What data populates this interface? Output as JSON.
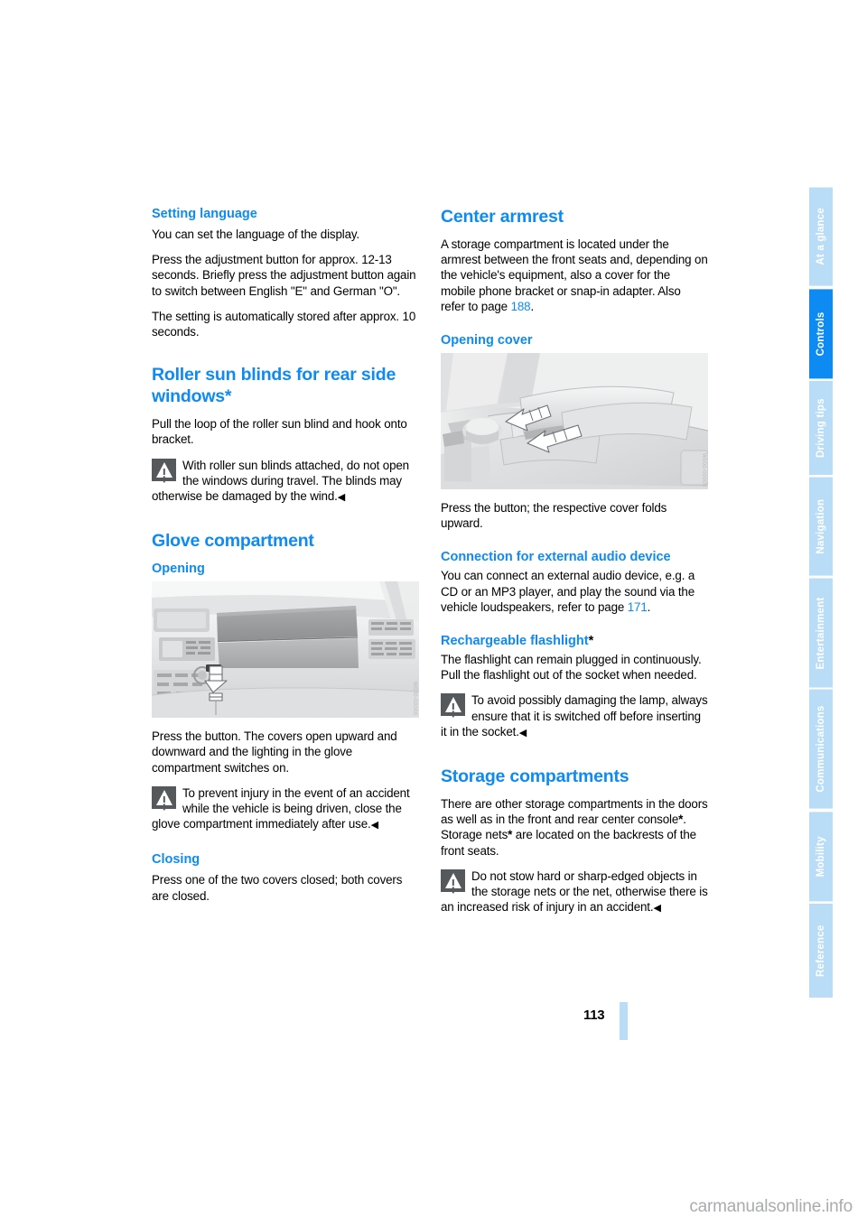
{
  "document": {
    "page_number": "113",
    "watermark": "carmanualsonline.info"
  },
  "sidebar": {
    "tabs": [
      {
        "label": "At a glance",
        "active": false
      },
      {
        "label": "Controls",
        "active": true
      },
      {
        "label": "Driving tips",
        "active": false
      },
      {
        "label": "Navigation",
        "active": false
      },
      {
        "label": "Entertainment",
        "active": false
      },
      {
        "label": "Communications",
        "active": false
      },
      {
        "label": "Mobility",
        "active": false
      },
      {
        "label": "Reference",
        "active": false
      }
    ],
    "active_color": "#0d8bf2",
    "inactive_color": "#b9dcf7"
  },
  "left_column": {
    "setting_language": {
      "heading": "Setting language",
      "p1": "You can set the language of the display.",
      "p2": "Press the adjustment button for approx. 12-13 seconds. Briefly press the adjustment button again to switch between English \"E\" and German \"O\".",
      "p3": "The setting is automatically stored after approx. 10 seconds."
    },
    "roller_sun_blinds": {
      "heading": "Roller sun blinds for rear side windows*",
      "p1": "Pull the loop of the roller sun blind and hook onto bracket.",
      "warning": "With roller sun blinds attached, do not open the windows during travel. The blinds may otherwise be damaged by the wind."
    },
    "glove_compartment": {
      "heading": "Glove compartment",
      "opening_sub": "Opening",
      "figure_alt": "dashboard-glove-compartment-illustration",
      "figure_watermark": "W000-00000",
      "p1": "Press the button. The covers open upward and downward and the lighting in the glove compartment switches on.",
      "warning": "To prevent injury in the event of an accident while the vehicle is being driven, close the glove compartment immediately after use.",
      "closing_sub": "Closing",
      "p2": "Press one of the two covers closed; both covers are closed."
    }
  },
  "right_column": {
    "center_armrest": {
      "heading": "Center armrest",
      "p1_a": "A storage compartment is located under the armrest between the front seats and, depending on the vehicle's equipment, also a cover for the mobile phone bracket or snap-in adapter. Also refer to page ",
      "p1_ref": "188",
      "p1_b": ".",
      "opening_cover_sub": "Opening cover",
      "figure_alt": "center-console-armrest-illustration",
      "figure_watermark": "W000-00000",
      "p2": "Press the button; the respective cover folds upward."
    },
    "external_audio": {
      "heading": "Connection for external audio device",
      "p1_a": "You can connect an external audio device, e.g. a CD or an MP3 player, and play the sound via the vehicle loudspeakers, refer to page ",
      "p1_ref": "171",
      "p1_b": "."
    },
    "flashlight": {
      "heading": "Rechargeable flashlight",
      "heading_star": "*",
      "p1": "The flashlight can remain plugged in continuously. Pull the flashlight out of the socket when needed.",
      "warning": "To avoid possibly damaging the lamp, always ensure that it is switched off before inserting it in the socket."
    },
    "storage_compartments": {
      "heading": "Storage compartments",
      "p1_a": "There are other storage compartments in the doors as well as in the front and rear center console",
      "p1_star": "*",
      "p1_b": ".",
      "p2_a": "Storage nets",
      "p2_star": "*",
      "p2_b": " are located on the backrests of the front seats.",
      "warning": "Do not stow hard or sharp-edged objects in the storage nets or the net, otherwise there is an increased risk of injury in an accident."
    }
  }
}
